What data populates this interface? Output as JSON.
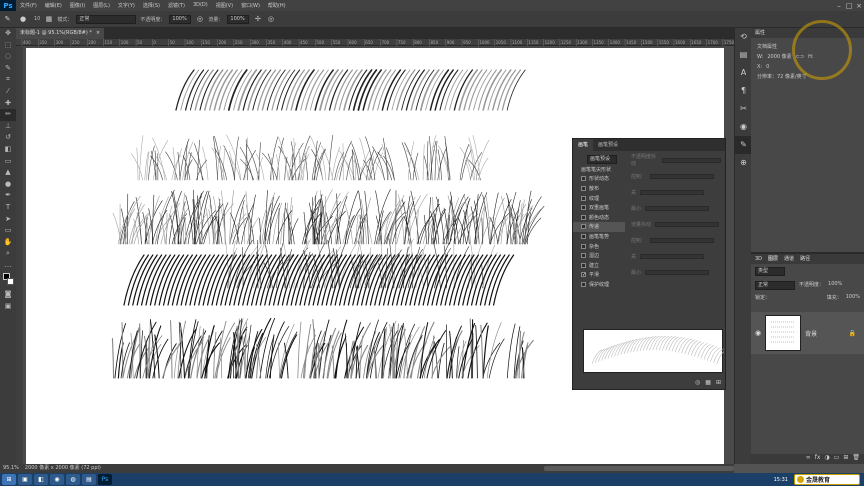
{
  "app": {
    "logo": "Ps"
  },
  "menu": [
    "文件(F)",
    "编辑(E)",
    "图像(I)",
    "图层(L)",
    "文字(Y)",
    "选择(S)",
    "滤镜(T)",
    "3D(D)",
    "视图(V)",
    "窗口(W)",
    "帮助(H)"
  ],
  "options": {
    "brush_size": "10",
    "mode_label": "模式：",
    "mode_value": "正常",
    "opacity_label": "不透明度：",
    "opacity_value": "100%",
    "flow_label": "流量：",
    "flow_value": "100%"
  },
  "document_tab": {
    "title": "未标题-1 @ 95.1%(RGB/8#) *",
    "close": "×"
  },
  "ruler_ticks": [
    "400",
    "350",
    "300",
    "250",
    "200",
    "150",
    "100",
    "50",
    "0",
    "50",
    "100",
    "150",
    "200",
    "250",
    "300",
    "350",
    "400",
    "450",
    "500",
    "550",
    "600",
    "650",
    "700",
    "750",
    "800",
    "850",
    "900",
    "950",
    "1000",
    "1050",
    "1100",
    "1150",
    "1200",
    "1250",
    "1300",
    "1350",
    "1400",
    "1450",
    "1500",
    "1550",
    "1600",
    "1650",
    "1700",
    "1750"
  ],
  "status": {
    "zoom": "95.1%",
    "doc_info": "2000 像素 x 2000 像素 (72 ppi)"
  },
  "properties": {
    "title": "属性",
    "doc_props": "文档属性",
    "w_label": "W:",
    "w_value": "2000 像素",
    "h_label": "H:",
    "h_value": "0",
    "x_label": "X:",
    "x_value": "0",
    "resolution": "分辨率：72 像素/英寸"
  },
  "layers": {
    "tabs": [
      "3D",
      "图层",
      "通道",
      "路径"
    ],
    "kind": "类型",
    "mode": "正常",
    "opacity_label": "不透明度：",
    "opacity_value": "100%",
    "lock_label": "锁定：",
    "fill_label": "填充：",
    "fill_value": "100%",
    "layer_name": "背景"
  },
  "brush_panel": {
    "tabs": [
      "画笔",
      "画笔预设"
    ],
    "preset_button": "画笔预设",
    "items": [
      {
        "label": "画笔笔尖形状",
        "checked": false
      },
      {
        "label": "形状动态",
        "checked": false
      },
      {
        "label": "散布",
        "checked": false
      },
      {
        "label": "纹理",
        "checked": false
      },
      {
        "label": "双重画笔",
        "checked": false
      },
      {
        "label": "颜色动态",
        "checked": false
      },
      {
        "label": "传递",
        "checked": false
      },
      {
        "label": "画笔笔势",
        "checked": false
      },
      {
        "label": "杂色",
        "checked": false
      },
      {
        "label": "湿边",
        "checked": false
      },
      {
        "label": "建立",
        "checked": false
      },
      {
        "label": "平滑",
        "checked": true
      },
      {
        "label": "保护纹理",
        "checked": false
      }
    ],
    "right_rows": [
      "不透明度抖动",
      "控制：",
      "关",
      "最小",
      "流量抖动",
      "控制：",
      "关",
      "最小"
    ]
  },
  "taskbar": {
    "time": "15:31",
    "badge": "金晟教育"
  },
  "colors": {
    "accent": "#31a8ff",
    "brand": "#d6a400"
  }
}
